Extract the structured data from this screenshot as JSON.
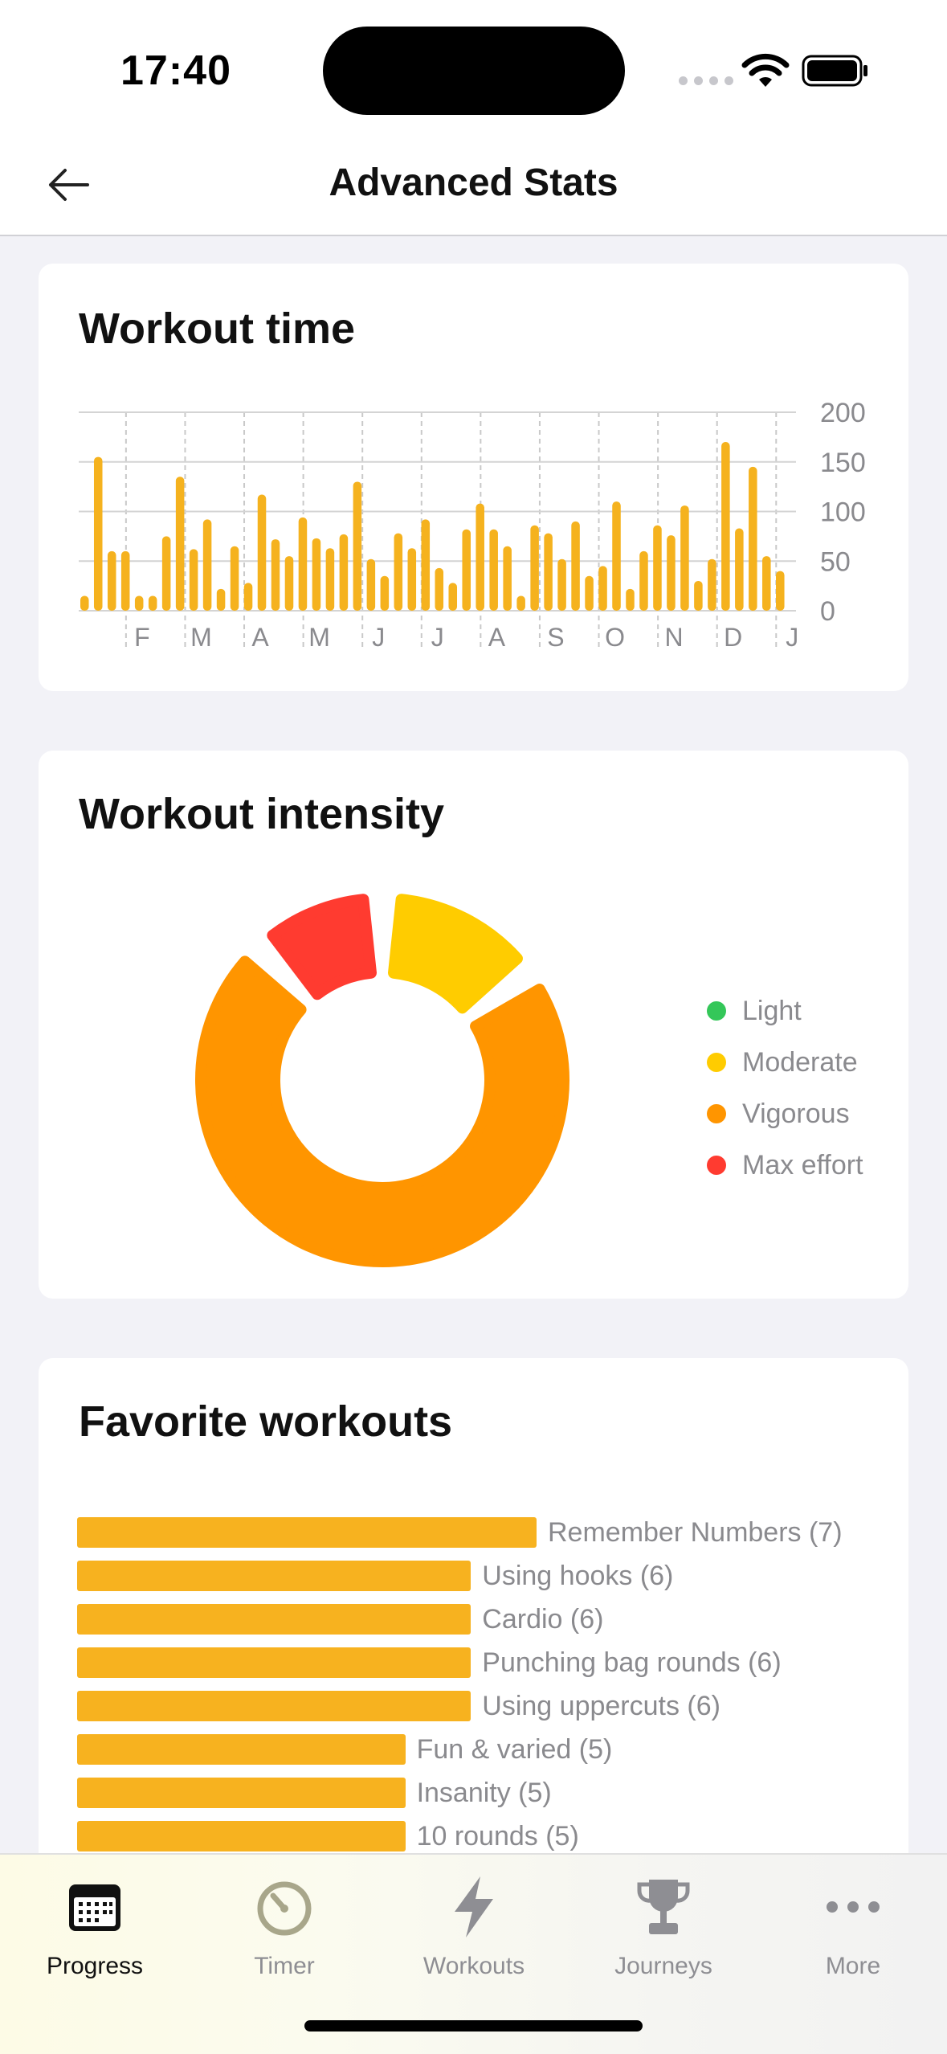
{
  "status": {
    "time": "17:40"
  },
  "nav": {
    "title": "Advanced Stats"
  },
  "workout_time": {
    "title": "Workout time",
    "chart_data": {
      "type": "bar",
      "title": "Workout time",
      "month_labels": [
        "F",
        "M",
        "A",
        "M",
        "J",
        "J",
        "A",
        "S",
        "O",
        "N",
        "D",
        "J"
      ],
      "y_ticks": [
        0,
        50,
        100,
        150,
        200
      ],
      "ylim": [
        0,
        200
      ],
      "values": [
        15,
        155,
        60,
        60,
        15,
        15,
        75,
        135,
        62,
        92,
        22,
        65,
        28,
        117,
        72,
        55,
        94,
        73,
        63,
        77,
        130,
        52,
        35,
        78,
        63,
        92,
        43,
        28,
        82,
        108,
        82,
        65,
        15,
        86,
        78,
        52,
        90,
        35,
        45,
        110,
        22,
        60,
        86,
        76,
        106,
        30,
        52,
        170,
        83,
        145,
        55,
        40
      ],
      "grid": true,
      "color": "#f5b21e"
    }
  },
  "intensity": {
    "title": "Workout intensity",
    "legend": [
      {
        "label": "Light",
        "color": "#34c759"
      },
      {
        "label": "Moderate",
        "color": "#ffcc00"
      },
      {
        "label": "Vigorous",
        "color": "#ff9500"
      },
      {
        "label": "Max effort",
        "color": "#ff3b30"
      }
    ],
    "chart_data": {
      "type": "pie",
      "title": "Workout intensity",
      "labels": [
        "Light",
        "Moderate",
        "Vigorous",
        "Max effort"
      ],
      "values": [
        0,
        15,
        73,
        12
      ],
      "unit": "%",
      "colors": [
        "#34c759",
        "#ffcc00",
        "#ff9500",
        "#ff3b30"
      ]
    }
  },
  "favorites": {
    "title": "Favorite workouts",
    "items": [
      {
        "label": "Remember Numbers (7)",
        "count": 7
      },
      {
        "label": "Using hooks (6)",
        "count": 6
      },
      {
        "label": "Cardio (6)",
        "count": 6
      },
      {
        "label": "Punching bag rounds (6)",
        "count": 6
      },
      {
        "label": "Using uppercuts (6)",
        "count": 6
      },
      {
        "label": "Fun & varied (5)",
        "count": 5
      },
      {
        "label": "Insanity (5)",
        "count": 5
      },
      {
        "label": "10 rounds (5)",
        "count": 5
      }
    ],
    "chart_data": {
      "type": "bar",
      "orientation": "horizontal",
      "categories": [
        "Remember Numbers",
        "Using hooks",
        "Cardio",
        "Punching bag rounds",
        "Using uppercuts",
        "Fun & varied",
        "Insanity",
        "10 rounds"
      ],
      "values": [
        7,
        6,
        6,
        6,
        6,
        5,
        5,
        5
      ]
    }
  },
  "tabs": [
    {
      "label": "Progress",
      "icon": "calendar-icon",
      "active": true
    },
    {
      "label": "Timer",
      "icon": "stopwatch-icon",
      "active": false
    },
    {
      "label": "Workouts",
      "icon": "lightning-icon",
      "active": false
    },
    {
      "label": "Journeys",
      "icon": "trophy-icon",
      "active": false
    },
    {
      "label": "More",
      "icon": "ellipsis-icon",
      "active": false
    }
  ]
}
